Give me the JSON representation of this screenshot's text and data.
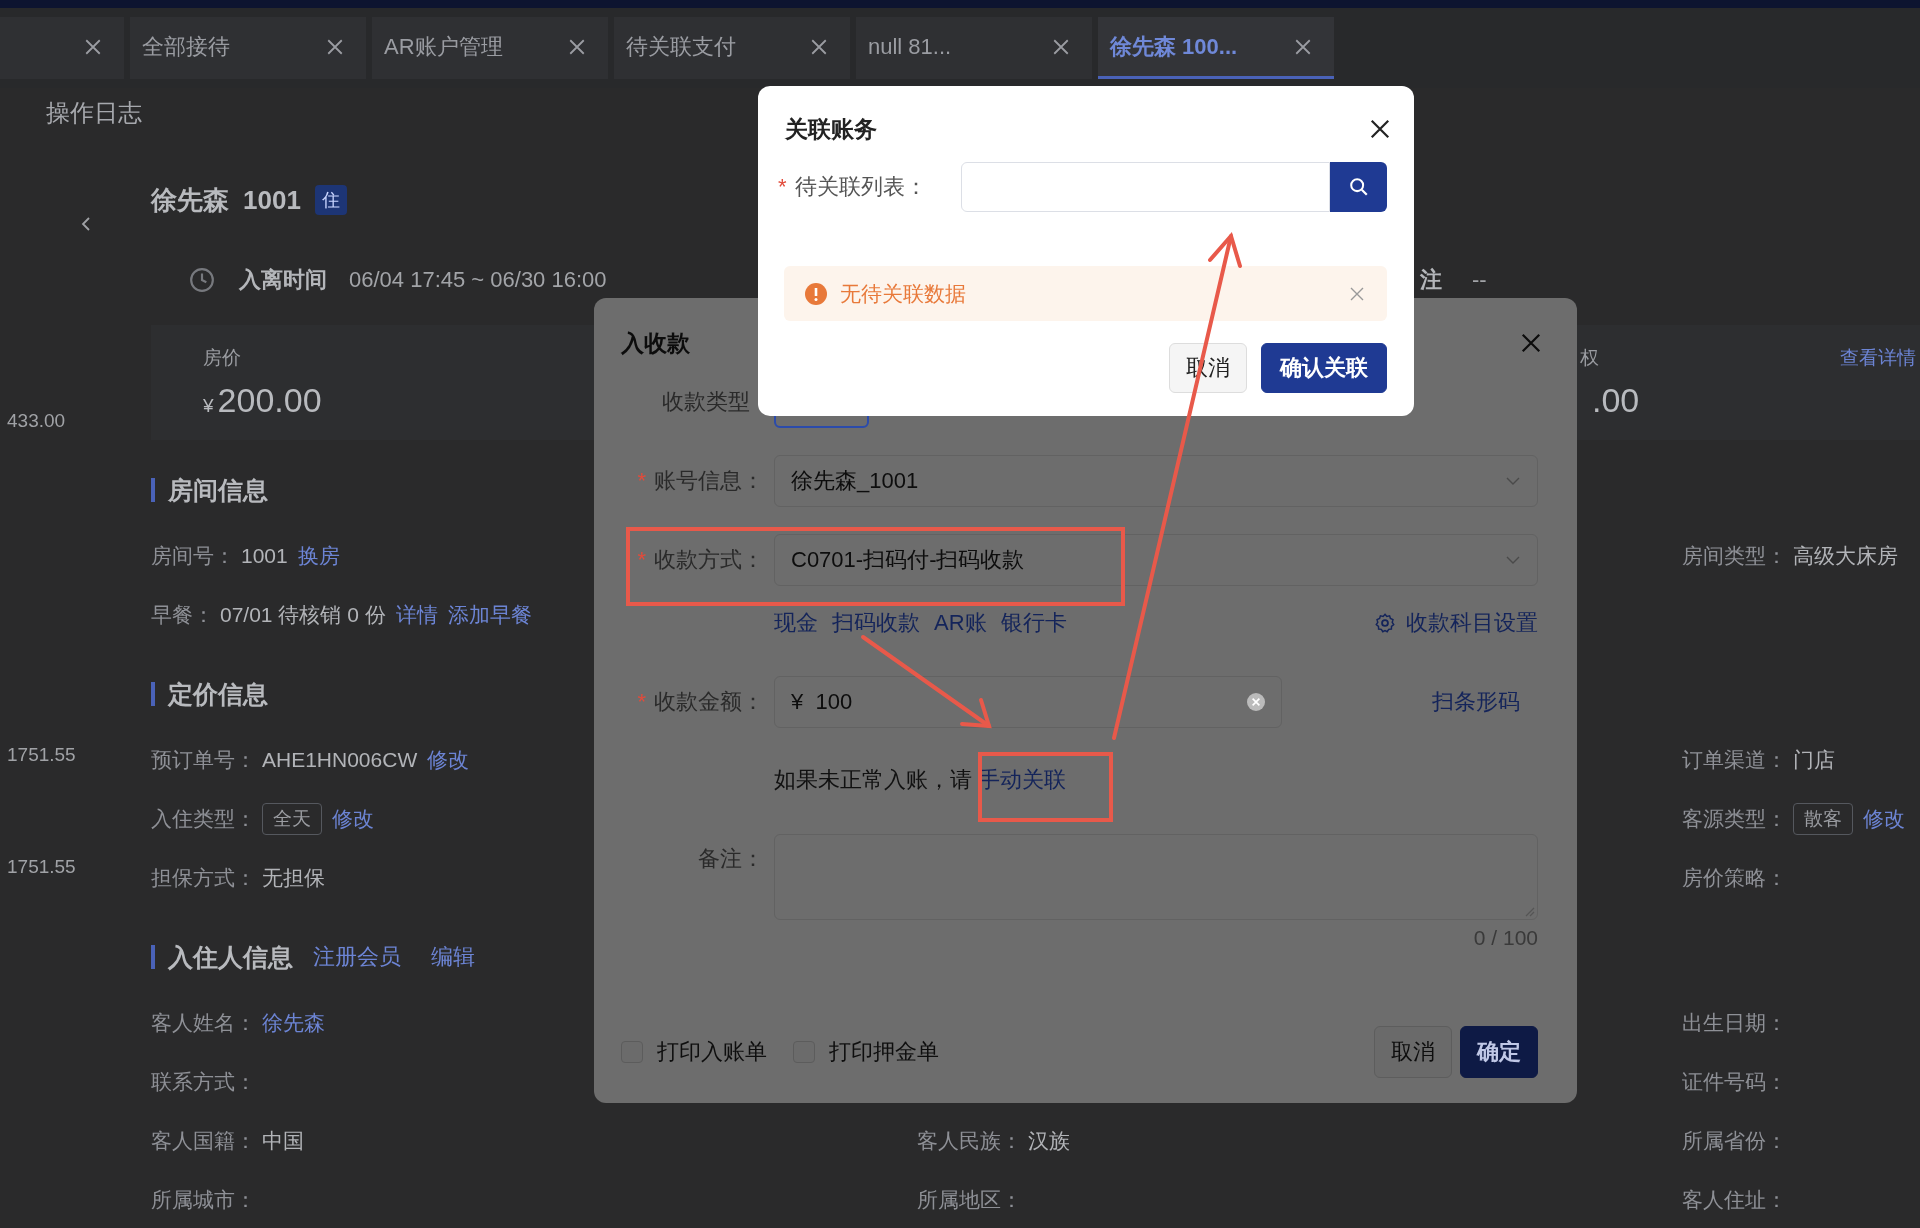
{
  "tabs": [
    {
      "selected": false
    },
    {
      "label": "全部接待",
      "selected": false
    },
    {
      "label": "AR账户管理",
      "selected": false
    },
    {
      "label": "待关联支付",
      "selected": false
    },
    {
      "label": "null 81...",
      "selected": false
    },
    {
      "label": "徐先森 100...",
      "selected": true
    }
  ],
  "page_tab": "操作日志",
  "side_amounts": [
    "433.00",
    "1751.55",
    "1751.55"
  ],
  "guest_header": {
    "name": "徐先森",
    "room": "1001",
    "status_badge": "住"
  },
  "stay": {
    "label": "入离时间",
    "value": "06/04 17:45 ~ 06/30 16:00",
    "note_label": "注",
    "note_value": "--"
  },
  "price_card": {
    "label": "房价",
    "currency": "¥",
    "amount": "200.00",
    "right_label": "权",
    "right_amount": ".00",
    "detail_link": "查看详情"
  },
  "sections": [
    {
      "title": "房间信息",
      "rows": [
        {
          "left": {
            "label": "房间号：",
            "parts": [
              {
                "kind": "text",
                "text": "1001"
              },
              {
                "kind": "link",
                "text": "换房"
              }
            ]
          },
          "right": {
            "label": "房间类型：",
            "parts": [
              {
                "kind": "text",
                "text": "高级大床房"
              }
            ]
          }
        },
        {
          "left": {
            "label": "早餐：",
            "parts": [
              {
                "kind": "text",
                "text": "07/01 待核销 0 份"
              },
              {
                "kind": "link",
                "text": "详情"
              },
              {
                "kind": "link",
                "text": "添加早餐"
              }
            ]
          }
        }
      ]
    },
    {
      "title": "定价信息",
      "rows": [
        {
          "left": {
            "label": "预订单号：",
            "parts": [
              {
                "kind": "text",
                "text": "AHE1HN006CW"
              },
              {
                "kind": "link",
                "text": "修改"
              }
            ]
          },
          "right": {
            "label": "订单渠道：",
            "parts": [
              {
                "kind": "text",
                "text": "门店"
              }
            ]
          }
        },
        {
          "left": {
            "label": "入住类型：",
            "parts": [
              {
                "kind": "tag",
                "text": "全天"
              },
              {
                "kind": "link",
                "text": "修改"
              }
            ]
          },
          "right": {
            "label": "客源类型：",
            "parts": [
              {
                "kind": "tag",
                "text": "散客"
              },
              {
                "kind": "link",
                "text": "修改"
              }
            ]
          }
        },
        {
          "left": {
            "label": "担保方式：",
            "parts": [
              {
                "kind": "text",
                "text": "无担保"
              }
            ]
          },
          "right": {
            "label": "房价策略："
          }
        }
      ]
    },
    {
      "title": "入住人信息",
      "links": [
        "注册会员",
        "编辑"
      ],
      "rows": [
        {
          "left": {
            "label": "客人姓名：",
            "parts": [
              {
                "kind": "link",
                "text": "徐先森"
              }
            ]
          },
          "right": {
            "label": "出生日期："
          }
        },
        {
          "left": {
            "label": "联系方式："
          },
          "right": {
            "label": "证件号码："
          }
        },
        {
          "left": {
            "label": "客人国籍：",
            "parts": [
              {
                "kind": "text",
                "text": "中国"
              }
            ]
          },
          "middle": {
            "label": "客人民族：",
            "parts": [
              {
                "kind": "text",
                "text": "汉族"
              }
            ]
          },
          "right": {
            "label": "所属省份："
          }
        },
        {
          "left": {
            "label": "所属城市："
          },
          "middle": {
            "label": "所属地区："
          },
          "right": {
            "label": "客人住址："
          }
        }
      ]
    }
  ],
  "payment_dialog": {
    "title": "入收款",
    "rows": [
      {
        "kind": "segmented",
        "label": "收款类型"
      },
      {
        "kind": "select",
        "mark": "*",
        "label": "账号信息：",
        "value": "徐先森_1001"
      },
      {
        "kind": "select",
        "mark": "*",
        "label": "收款方式：",
        "value": "C0701-扫码付-扫码收款"
      },
      {
        "kind": "links",
        "links": [
          "现金",
          "扫码收款",
          "AR账",
          "银行卡"
        ],
        "settings_link": "收款科目设置"
      },
      {
        "kind": "amount",
        "mark": "*",
        "label": "收款金额：",
        "currency": "¥",
        "value": "100",
        "side_link": "扫条形码"
      },
      {
        "kind": "hint",
        "text": "如果未正常入账，请",
        "link": "手动关联"
      },
      {
        "kind": "textarea",
        "label": "备注：",
        "counter": "0 / 100"
      }
    ],
    "options": [
      {
        "label": "打印入账单",
        "checked": false
      },
      {
        "label": "打印押金单",
        "checked": false
      }
    ],
    "cancel": "取消",
    "confirm": "确定"
  },
  "link_dialog": {
    "title": "关联账务",
    "field": {
      "mark": "*",
      "label": "待关联列表："
    },
    "alert": {
      "kind": "warning",
      "text": "无待关联数据"
    },
    "cancel": "取消",
    "confirm": "确认关联"
  }
}
